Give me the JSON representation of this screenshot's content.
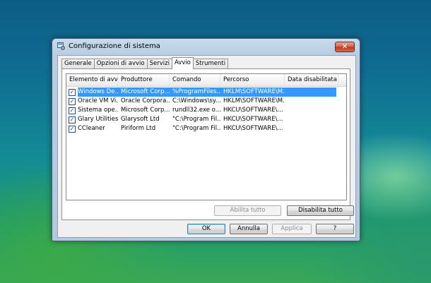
{
  "window": {
    "title": "Configurazione di sistema",
    "close_label": "✕"
  },
  "tabs": [
    {
      "label": "Generale",
      "active": false
    },
    {
      "label": "Opzioni di avvio",
      "active": false
    },
    {
      "label": "Servizi",
      "active": false
    },
    {
      "label": "Avvio",
      "active": true
    },
    {
      "label": "Strumenti",
      "active": false
    }
  ],
  "startup_list": {
    "columns": [
      "Elemento di avvio",
      "Produttore",
      "Comando",
      "Percorso",
      "Data disabilitata"
    ],
    "rows": [
      {
        "checked": true,
        "selected": true,
        "item": "Windows De...",
        "maker": "Microsoft Corp...",
        "command": "%ProgramFiles...",
        "path": "HKLM\\SOFTWARE\\M...",
        "disabled_date": ""
      },
      {
        "checked": true,
        "selected": false,
        "item": "Oracle VM Vi...",
        "maker": "Oracle Corpora...",
        "command": "C:\\Windows\\sy...",
        "path": "HKLM\\SOFTWARE\\M...",
        "disabled_date": ""
      },
      {
        "checked": true,
        "selected": false,
        "item": "Sistema ope...",
        "maker": "Microsoft Corp...",
        "command": "rundll32.exe o...",
        "path": "HKCU\\SOFTWARE\\...",
        "disabled_date": ""
      },
      {
        "checked": true,
        "selected": false,
        "item": "Glary Utilities",
        "maker": "Glarysoft Ltd",
        "command": "\"C:\\Program Fil...",
        "path": "HKCU\\SOFTWARE\\...",
        "disabled_date": ""
      },
      {
        "checked": true,
        "selected": false,
        "item": "CCleaner",
        "maker": "Piriform Ltd",
        "command": "\"C:\\Program Fil...",
        "path": "HKCU\\SOFTWARE\\...",
        "disabled_date": ""
      }
    ]
  },
  "buttons": {
    "enable_all": "Abilita tutto",
    "disable_all": "Disabilita tutto",
    "ok": "OK",
    "cancel": "Annulla",
    "apply": "Applica",
    "help": "?"
  },
  "colors": {
    "selection": "#3399ff",
    "close_button": "#c8452f"
  }
}
